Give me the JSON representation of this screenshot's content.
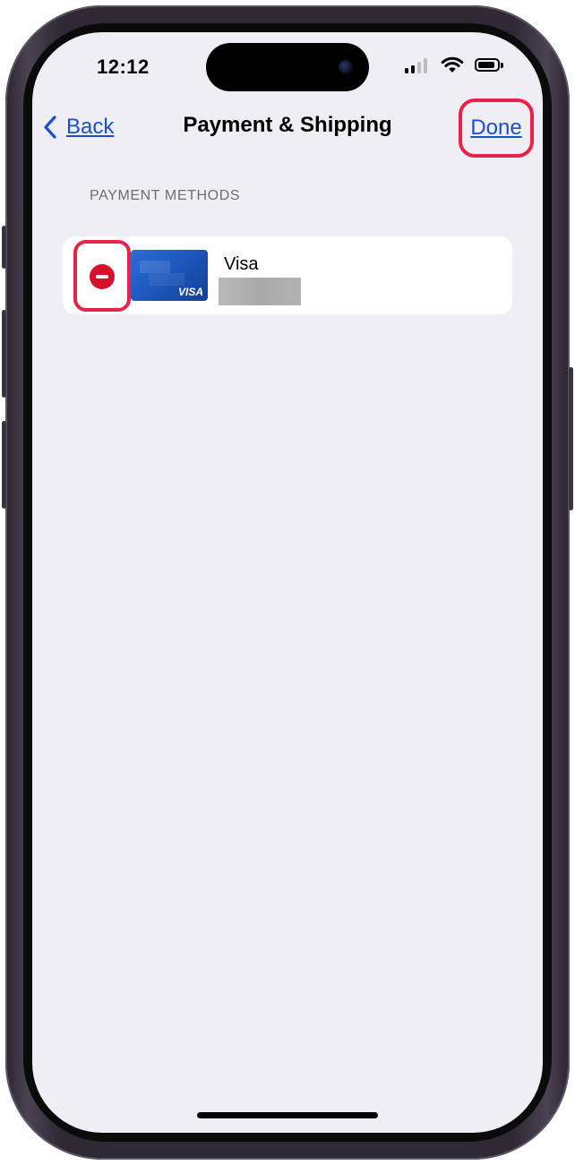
{
  "status_bar": {
    "time": "12:12",
    "signal_icon": "cellular-signal-icon",
    "wifi_icon": "wifi-icon",
    "battery_icon": "battery-icon"
  },
  "nav": {
    "back_label": "Back",
    "back_icon": "chevron-left-icon",
    "title": "Payment & Shipping",
    "done_label": "Done"
  },
  "payment_methods": {
    "header": "PAYMENT METHODS",
    "items": [
      {
        "name": "Visa",
        "card_brand_text": "VISA",
        "delete_icon": "minus-circle-icon"
      }
    ]
  },
  "colors": {
    "accent_link": "#1a4fcf",
    "highlight_annotation": "#e8234a",
    "delete_red": "#d8102c",
    "background": "#efeef4"
  }
}
